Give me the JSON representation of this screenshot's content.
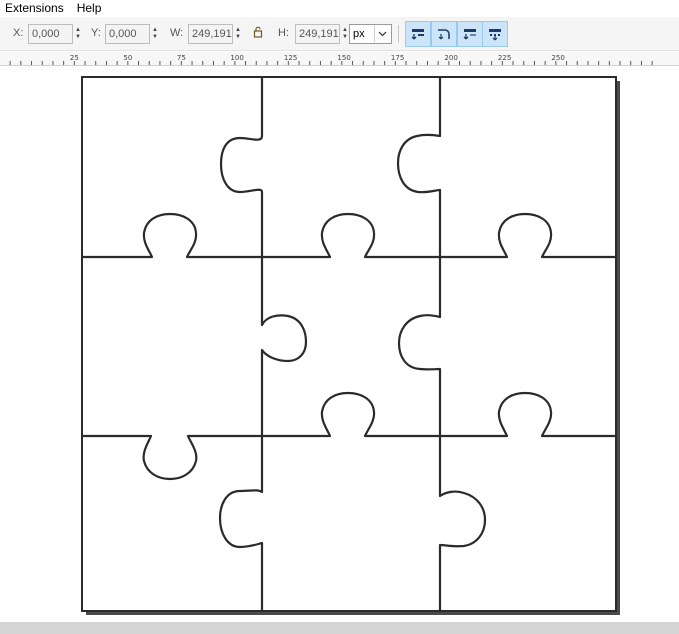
{
  "menu": {
    "items": [
      {
        "label": "Extensions"
      },
      {
        "label": "Help"
      }
    ]
  },
  "toolbar": {
    "x_label": "X:",
    "x_value": "0,000",
    "y_label": "Y:",
    "y_value": "0,000",
    "w_label": "W:",
    "w_value": "249,191",
    "h_label": "H:",
    "h_value": "249,191",
    "unit": "px",
    "toggle_icons": [
      "scale-stroke-icon",
      "scale-corners-icon",
      "move-gradients-icon",
      "move-patterns-icon"
    ]
  },
  "ruler": {
    "labels": [
      "25",
      "50",
      "75",
      "100",
      "125",
      "150",
      "175",
      "200",
      "225",
      "250"
    ]
  },
  "colors": {
    "toggle_active_bg": "#cce4f7",
    "toggle_active_border": "#99c9ef",
    "puzzle_stroke": "#2b2b2b",
    "page_shadow": "#4a4a4a"
  }
}
